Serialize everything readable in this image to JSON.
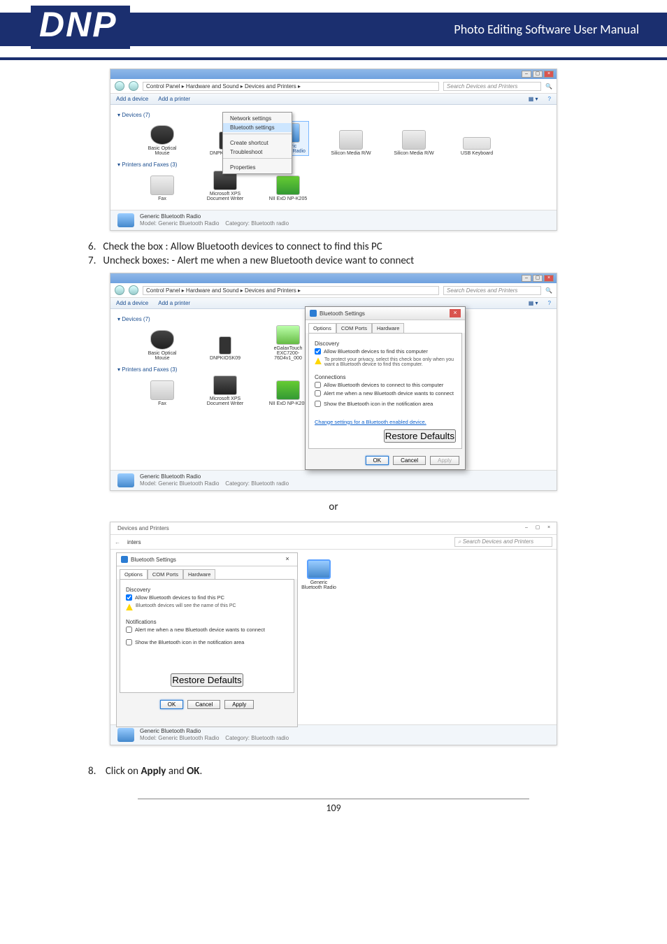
{
  "header": {
    "logo_text": "DNP",
    "manual_title": "Photo Editing Software User Manual"
  },
  "steps": {
    "s6": "Check the box : Allow Bluetooth devices to connect to find this PC",
    "s7": "Uncheck boxes: - Alert me when a new Bluetooth device want to connect",
    "s8_prefix": "Click on ",
    "s8_apply": "Apply",
    "s8_and": " and ",
    "s8_ok": "OK",
    "s8_suffix": "."
  },
  "or_text": "or",
  "page_number": "109",
  "win7": {
    "breadcrumb": "Control Panel  ▸  Hardware and Sound  ▸  Devices and Printers  ▸",
    "search_placeholder": "Search Devices and Printers",
    "toolbar_add_device": "Add a device",
    "toolbar_add_printer": "Add a printer",
    "section_devices": "Devices (7)",
    "section_printers": "Printers and Faxes (3)",
    "devices": [
      "Basic Optical Mouse",
      "DNPKIOSK09",
      "eGalaxTouch EXC7200-76D4v1_000",
      "Generic Bluetooth Radio",
      "Silicon Media R/W",
      "Silicon Media R/W",
      "USB Keyboard"
    ],
    "printers": [
      "Fax",
      "Microsoft XPS Document Writer",
      "NII ExD NP-K205"
    ],
    "status_name": "Generic Bluetooth Radio",
    "status_model": "Model: Generic Bluetooth Radio",
    "status_category": "Category: Bluetooth radio"
  },
  "context_menu": {
    "items": [
      "Network settings",
      "Bluetooth settings",
      "Create shortcut",
      "Troubleshoot",
      "Properties"
    ],
    "highlight": "Bluetooth settings"
  },
  "bt_settings_win7": {
    "title": "Bluetooth Settings",
    "tabs": [
      "Options",
      "COM Ports",
      "Hardware"
    ],
    "discovery_label": "Discovery",
    "allow_find": "Allow Bluetooth devices to find this computer",
    "warn_text": "To protect your privacy, select this check box only when you want a Bluetooth device to find this computer.",
    "connections_label": "Connections",
    "allow_connect": "Allow Bluetooth devices to connect to this computer",
    "alert_connect": "Alert me when a new Bluetooth device wants to connect",
    "show_icon": "Show the Bluetooth icon in the notification area",
    "change_link": "Change settings for a Bluetooth enabled device.",
    "btn_restore": "Restore Defaults",
    "btn_ok": "OK",
    "btn_cancel": "Cancel",
    "btn_apply": "Apply"
  },
  "bt_settings_win10": {
    "window_title": "Devices and Printers",
    "panel_title": "Bluetooth Settings",
    "tabs": [
      "Options",
      "COM Ports",
      "Hardware"
    ],
    "discovery_label": "Discovery",
    "allow_find": "Allow Bluetooth devices to find this PC",
    "warn_text": "Bluetooth devices will see the name of this PC",
    "notifications_label": "Notifications",
    "alert_connect": "Alert me when a new Bluetooth device wants to connect",
    "show_icon": "Show the Bluetooth icon in the notification area",
    "btn_restore": "Restore Defaults",
    "btn_ok": "OK",
    "btn_cancel": "Cancel",
    "btn_apply": "Apply",
    "search_placeholder": "Search Devices and Printers",
    "right_label": "Generic Bluetooth Radio",
    "status_name": "Generic Bluetooth Radio",
    "status_model": "Model: Generic Bluetooth Radio",
    "status_category": "Category: Bluetooth radio",
    "addr_path_text": "inters"
  }
}
